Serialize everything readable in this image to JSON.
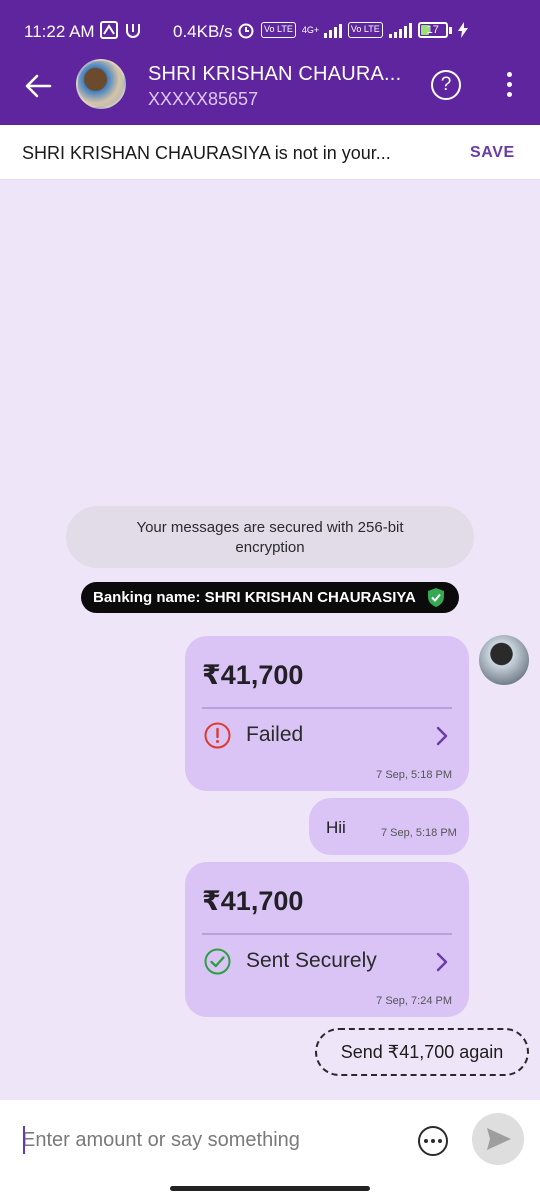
{
  "status_bar": {
    "time": "11:22 AM",
    "net_speed": "0.4KB/s",
    "network_type": "4G+",
    "volte_badge": "Vo LTE",
    "battery": "17",
    "icons": [
      "data-saver-icon",
      "app-notification-icon",
      "alarm-icon",
      "volte-icon",
      "signal-icon",
      "battery-icon",
      "charging-icon"
    ]
  },
  "header": {
    "contact_name": "SHRI KRISHAN CHAURA...",
    "contact_number": "XXXXX85657",
    "help_glyph": "?",
    "accent_color": "#5f259f"
  },
  "banner": {
    "text": "SHRI KRISHAN CHAURASIYA is not in your...",
    "save_label": "SAVE"
  },
  "chat": {
    "encryption_notice": "Your messages are secured with 256-bit encryption",
    "banking_name": "Banking name: SHRI KRISHAN CHAURASIYA",
    "messages": [
      {
        "type": "payment",
        "amount": "₹41,700",
        "status": "Failed",
        "time": "7 Sep, 5:18 PM",
        "status_color": "#e0392f"
      },
      {
        "type": "text",
        "text": "Hii",
        "time": "7 Sep, 5:18 PM"
      },
      {
        "type": "payment",
        "amount": "₹41,700",
        "status": "Sent Securely",
        "time": "7 Sep, 7:24 PM",
        "status_color": "#2f9e44"
      }
    ],
    "send_again_label": "Send ₹41,700 again"
  },
  "input": {
    "placeholder": "Enter amount or say something"
  }
}
